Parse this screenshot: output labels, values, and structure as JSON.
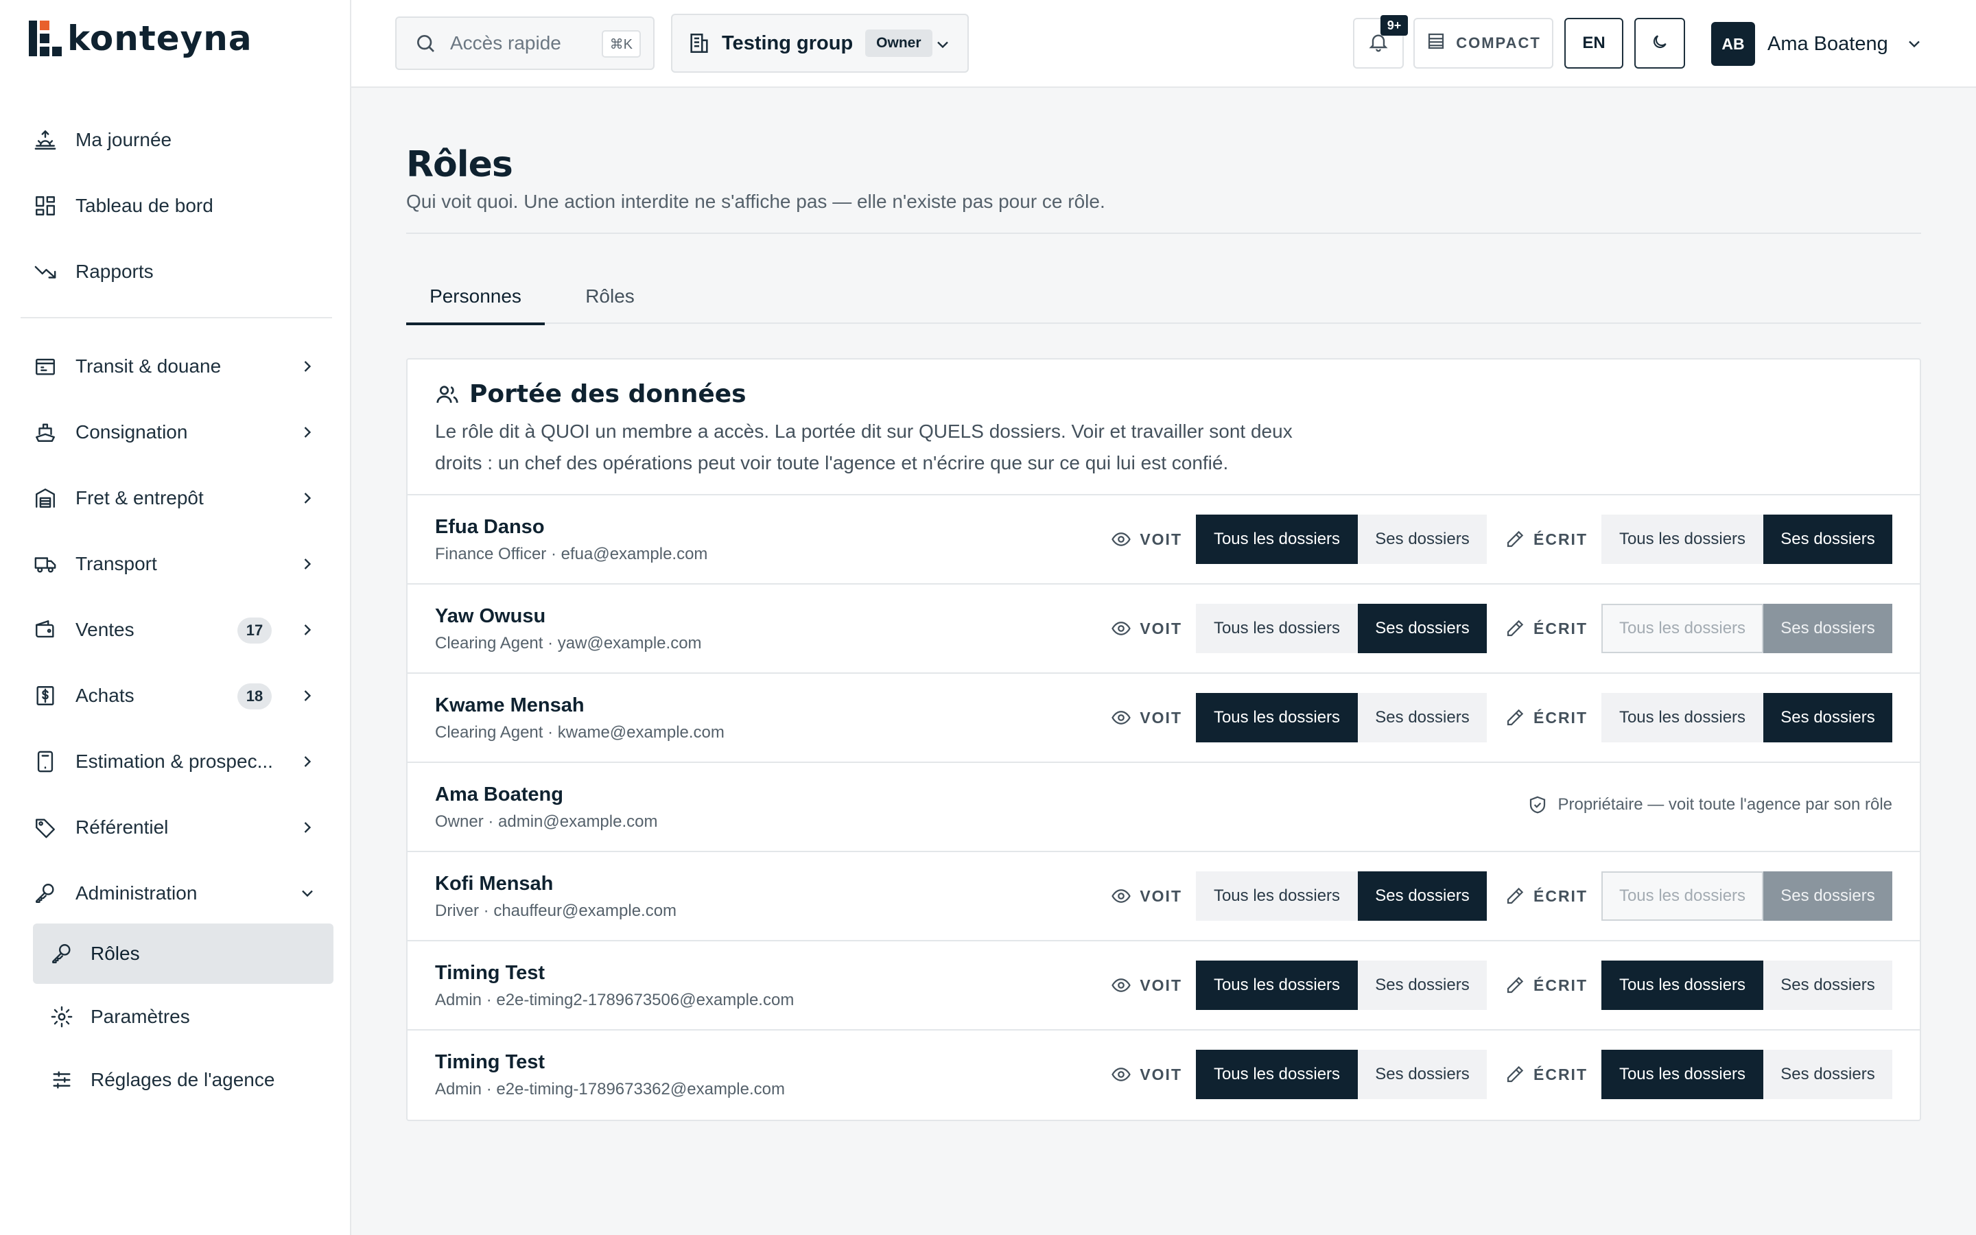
{
  "brand": {
    "name": "konteyna"
  },
  "sidebar": {
    "top_items": [
      {
        "label": "Ma journée",
        "icon": "sun-rise-icon"
      },
      {
        "label": "Tableau de bord",
        "icon": "dashboard-grid-icon"
      },
      {
        "label": "Rapports",
        "icon": "trend-down-icon"
      }
    ],
    "modules": [
      {
        "label": "Transit & douane",
        "icon": "customs-icon"
      },
      {
        "label": "Consignation",
        "icon": "ship-icon"
      },
      {
        "label": "Fret & entrepôt",
        "icon": "warehouse-icon"
      },
      {
        "label": "Transport",
        "icon": "truck-icon"
      },
      {
        "label": "Ventes",
        "icon": "wallet-icon",
        "badge": "17"
      },
      {
        "label": "Achats",
        "icon": "dollar-receipt-icon",
        "badge": "18"
      },
      {
        "label": "Estimation & prospec...",
        "icon": "calculator-icon"
      },
      {
        "label": "Référentiel",
        "icon": "tag-icon"
      },
      {
        "label": "Administration",
        "icon": "key-icon",
        "expanded": true
      }
    ],
    "admin_items": [
      {
        "label": "Rôles",
        "icon": "key-icon",
        "active": true
      },
      {
        "label": "Paramètres",
        "icon": "gear-icon"
      },
      {
        "label": "Réglages de l'agence",
        "icon": "sliders-icon"
      }
    ]
  },
  "topbar": {
    "quick_access": {
      "placeholder": "Accès rapide",
      "shortcut": "⌘K"
    },
    "group": {
      "name": "Testing group",
      "role": "Owner"
    },
    "notifications": {
      "count": "9+"
    },
    "density": "COMPACT",
    "language": "EN",
    "user": {
      "initials": "AB",
      "name": "Ama Boateng"
    }
  },
  "page": {
    "title": "Rôles",
    "subtitle": "Qui voit quoi. Une action interdite ne s'affiche pas — elle n'existe pas pour ce rôle.",
    "tabs": [
      {
        "label": "Personnes",
        "active": true
      },
      {
        "label": "Rôles",
        "active": false
      }
    ]
  },
  "scope": {
    "title": "Portée des données",
    "description": "Le rôle dit à QUOI un membre a accès. La portée dit sur QUELS dossiers. Voir et travailler sont deux droits : un chef des opérations peut voir toute l'agence et n'écrire que sur ce qui lui est confié.",
    "labels": {
      "read": "VOIT",
      "write": "ÉCRIT",
      "all": "Tous les dossiers",
      "own": "Ses dossiers"
    },
    "members": [
      {
        "name": "Efua Danso",
        "meta": "Finance Officer · efua@example.com",
        "read": "all",
        "write": "own",
        "write_disabled": false
      },
      {
        "name": "Yaw Owusu",
        "meta": "Clearing Agent · yaw@example.com",
        "read": "own",
        "write": "own",
        "write_disabled": true
      },
      {
        "name": "Kwame Mensah",
        "meta": "Clearing Agent · kwame@example.com",
        "read": "all",
        "write": "own",
        "write_disabled": false
      },
      {
        "name": "Ama Boateng",
        "meta": "Owner · admin@example.com",
        "owner_note": "Propriétaire — voit toute l'agence par son rôle"
      },
      {
        "name": "Kofi Mensah",
        "meta": "Driver · chauffeur@example.com",
        "read": "own",
        "write": "own",
        "write_disabled": true
      },
      {
        "name": "Timing Test",
        "meta": "Admin · e2e-timing2-1789673506@example.com",
        "read": "all",
        "write": "all",
        "write_disabled": false
      },
      {
        "name": "Timing Test",
        "meta": "Admin · e2e-timing-1789673362@example.com",
        "read": "all",
        "write": "all",
        "write_disabled": false
      }
    ]
  }
}
